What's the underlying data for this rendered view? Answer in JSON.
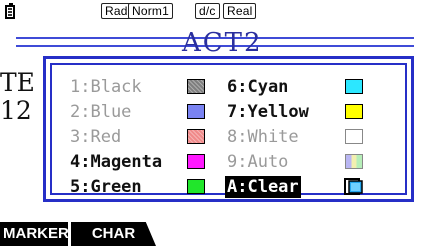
{
  "status": {
    "angle": "Rad",
    "display": "Norm1",
    "fraction": "d/c",
    "complex": "Real"
  },
  "background": {
    "title": "ACT2",
    "line1": "TE",
    "line2": "12"
  },
  "palette": {
    "items": [
      {
        "label": "1:Black",
        "state": "disabled",
        "color": "#7f7f7f"
      },
      {
        "label": "2:Blue",
        "state": "disabled",
        "color": "#7a83f2"
      },
      {
        "label": "3:Red",
        "state": "disabled",
        "color": "#f08a8a"
      },
      {
        "label": "4:Magenta",
        "state": "enabled",
        "color": "#ff19ff"
      },
      {
        "label": "5:Green",
        "state": "enabled",
        "color": "#21e62b"
      },
      {
        "label": "6:Cyan",
        "state": "enabled",
        "color": "#2ce7ff"
      },
      {
        "label": "7:Yellow",
        "state": "enabled",
        "color": "#ffff00"
      },
      {
        "label": "8:White",
        "state": "disabled",
        "color": "#ffffff"
      },
      {
        "label": "9:Auto",
        "state": "disabled",
        "color": "auto-gradient"
      },
      {
        "label": "A:Clear",
        "state": "selected",
        "color": "clear-icon"
      }
    ]
  },
  "fkeys": {
    "f1": "MARKER",
    "f2": "CHAR"
  },
  "colors": {
    "accent": "#262fc7",
    "title": "#2a2f9e"
  }
}
